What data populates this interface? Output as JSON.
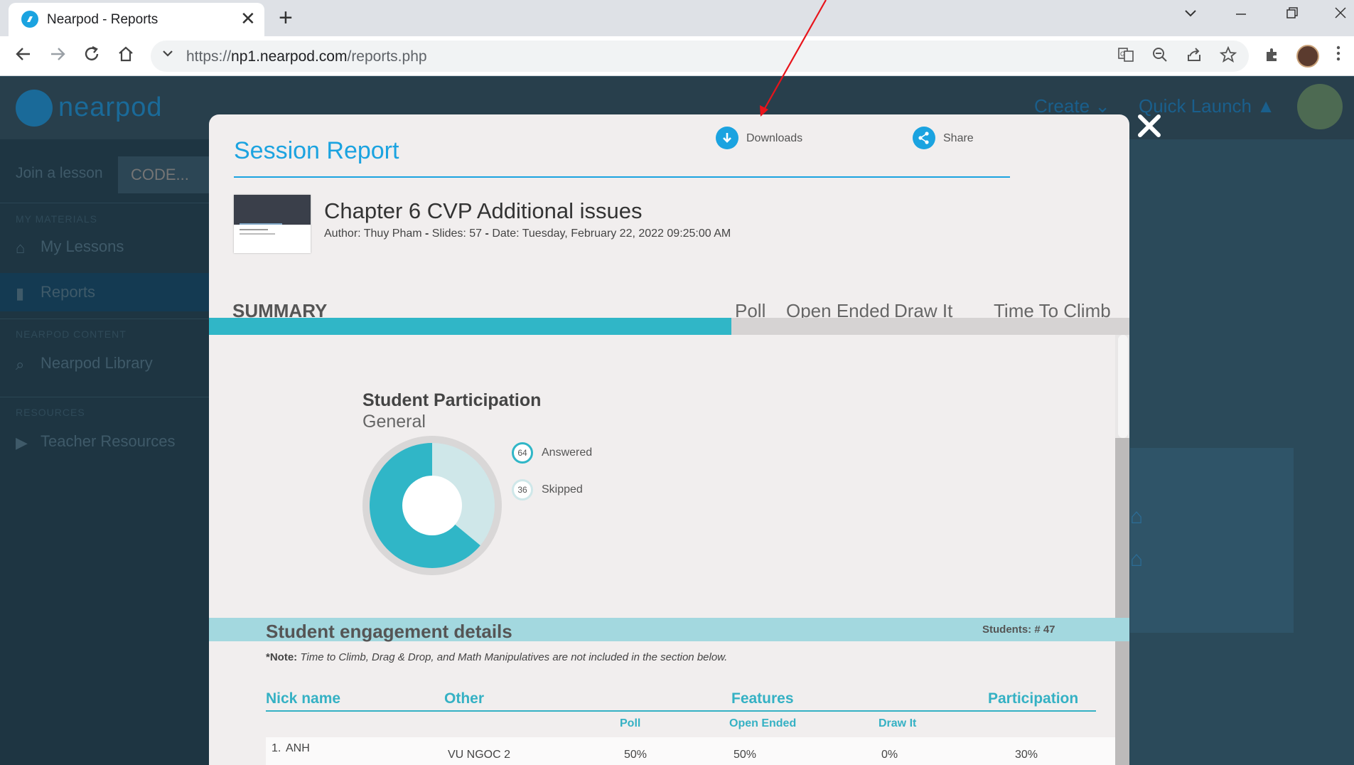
{
  "browser": {
    "tab_title": "Nearpod - Reports",
    "tab_close": "✕",
    "new_tab": "+",
    "url_scheme": "https://",
    "url_host": "np1.nearpod.com",
    "url_path": "/reports.php"
  },
  "nearpod": {
    "logo_text": "nearpod",
    "create_label": "Create",
    "quick_launch_label": "Quick Launch",
    "join_label": "Join a lesson",
    "code_placeholder": "CODE...",
    "sections": {
      "my_materials": "MY MATERIALS",
      "nearpod_content": "NEARPOD CONTENT",
      "resources": "RESOURCES"
    },
    "sidebar_items": [
      {
        "label": "My Lessons",
        "icon": "home-icon"
      },
      {
        "label": "Reports",
        "icon": "bar-chart-icon"
      },
      {
        "label": "Nearpod Library",
        "icon": "search-icon"
      },
      {
        "label": "Teacher Resources",
        "icon": "play-icon"
      }
    ]
  },
  "modal": {
    "title": "Session Report",
    "downloads_label": "Downloads",
    "share_label": "Share",
    "lesson_title": "Chapter 6 CVP Additional issues",
    "meta": {
      "author_label": "Author:",
      "author": "Thuy Pham",
      "slides_label": "Slides:",
      "slides": "57",
      "date_label": "Date:",
      "date": "Tuesday, February 22, 2022 09:25:00 AM"
    },
    "tabs": {
      "summary": "SUMMARY",
      "poll": "Poll",
      "open_ended": "Open Ended",
      "draw_it": "Draw It",
      "time_to_climb": "Time To Climb"
    },
    "participation": {
      "title": "Student Participation",
      "subtitle": "General",
      "answered_value": 64,
      "answered_text": "64",
      "answered_label": "Answered",
      "skipped_value": 36,
      "skipped_text": "36",
      "skipped_label": "Skipped",
      "colors": {
        "answered": "#30b6c7",
        "skipped": "#cfe7e9",
        "ring": "#d9d7d7"
      }
    },
    "engagement": {
      "title": "Student engagement details",
      "students_count": "Students: # 47",
      "note_label": "*Note:",
      "note_text": "Time to Climb, Drag & Drop, and Math Manipulatives are not included in the section below.",
      "headers": {
        "nick_name": "Nick name",
        "other": "Other",
        "features": "Features",
        "participation": "Participation"
      },
      "sub_headers": {
        "poll": "Poll",
        "open_ended": "Open Ended",
        "draw_it": "Draw It"
      },
      "rows": [
        {
          "index": "1.",
          "nick": "ANH",
          "other": "VU NGOC 2",
          "poll": "50%",
          "open_ended": "50%",
          "draw_it": "0%",
          "participation": "30%"
        }
      ]
    }
  },
  "colors": {
    "accent": "#1ba3e0",
    "teal": "#30b6c7",
    "annotation_arrow": "#e8141b"
  }
}
